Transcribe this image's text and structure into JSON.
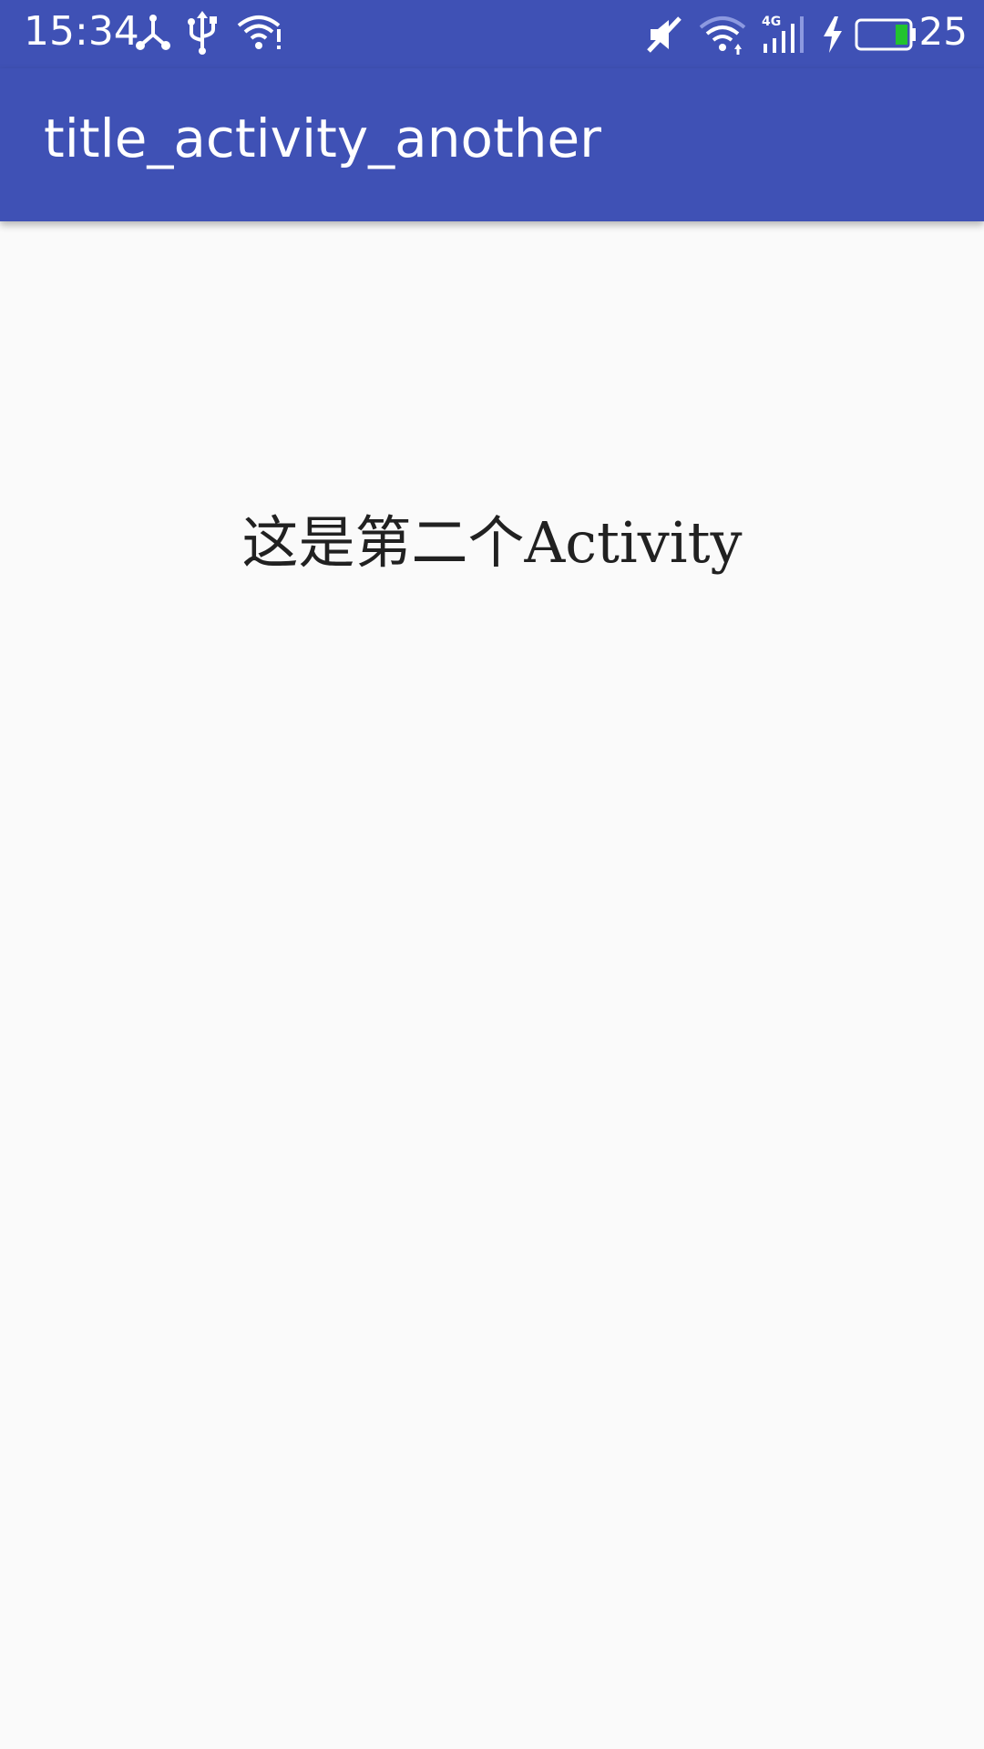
{
  "status_bar": {
    "time": "15:34",
    "battery_percent": "25",
    "network_type": "4G",
    "icons": [
      "share-icon",
      "usb-icon",
      "wifi-alert-icon",
      "mute-icon",
      "wifi-icon",
      "cellular-signal-icon",
      "charging-icon",
      "battery-icon"
    ],
    "battery_level_fraction": 0.25,
    "colors": {
      "background": "#3f51b5",
      "foreground": "#ffffff",
      "battery_fill": "#22c32e"
    }
  },
  "app_bar": {
    "title": "title_activity_another",
    "background": "#3f51b5"
  },
  "main": {
    "message": "这是第二个Activity",
    "background": "#fafafa"
  }
}
